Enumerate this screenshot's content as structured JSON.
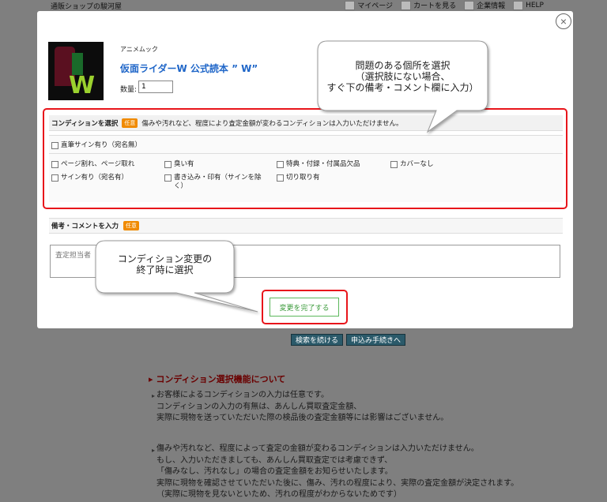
{
  "background": {
    "shop_name": "通販ショップの駿河屋",
    "nav": [
      {
        "label": "マイページ",
        "icon": "person-icon"
      },
      {
        "label": "カートを見る",
        "icon": "cart-icon"
      },
      {
        "label": "企業情報",
        "icon": "check-icon"
      },
      {
        "label": "HELP",
        "icon": "help-icon"
      }
    ],
    "buttons": {
      "continue": "検索を続ける",
      "apply": "申込み手続きへ"
    },
    "section_title": "コンディション選択機能について",
    "paragraph1": "お客様によるコンディションの入力は任意です。\nコンディションの入力の有無は、あんしん買取査定金額、\n実際に現物を送っていただいた際の検品後の査定金額等には影響はございません。",
    "paragraph2": "傷みや汚れなど、程度によって査定の金額が変わるコンディションは入力いただけません。\nもし、入力いただきましても、あんしん買取査定では考慮できず、\n「傷みなし、汚れなし」の場合の査定金額をお知らせいたします。\n実際に現物を確認させていただいた後に、傷み、汚れの程度により、実際の査定金額が決定されます。\n（実際に現物を見ないといため、汚れの程度がわからないためです）"
  },
  "modal": {
    "close_label": "×",
    "genre": "アニメムック",
    "title": "仮面ライダーW 公式読本 ” W”",
    "quantity_label": "数量:",
    "quantity_value": "1",
    "condition": {
      "header_label": "コンディションを選択",
      "badge": "任意",
      "hint": "傷みや汚れなど、程度により査定金額が変わるコンディションは入力いただけません。",
      "options_row1": [
        "直筆サイン有り（宛名無）"
      ],
      "options_row2": [
        "ページ割れ、ページ取れ",
        "臭い有",
        "特典・付録・付属品欠品",
        "カバーなし",
        "サイン有り（宛名有）",
        "書き込み・印有（サインを除く）",
        "切り取り有"
      ]
    },
    "note": {
      "label": "備考・コメントを入力",
      "badge": "任意",
      "placeholder": "査定担当者"
    },
    "submit_label": "変更を完了する"
  },
  "callouts": {
    "top": "問題のある個所を選択\n（選択肢にない場合、\nすぐ下の備考・コメント欄に入力）",
    "bottom": "コンディション変更の\n終了時に選択"
  },
  "colors": {
    "highlight": "#e8151b",
    "title_blue": "#1f66c8",
    "badge": "#f08a00",
    "submit_green": "#3a9a3a"
  }
}
